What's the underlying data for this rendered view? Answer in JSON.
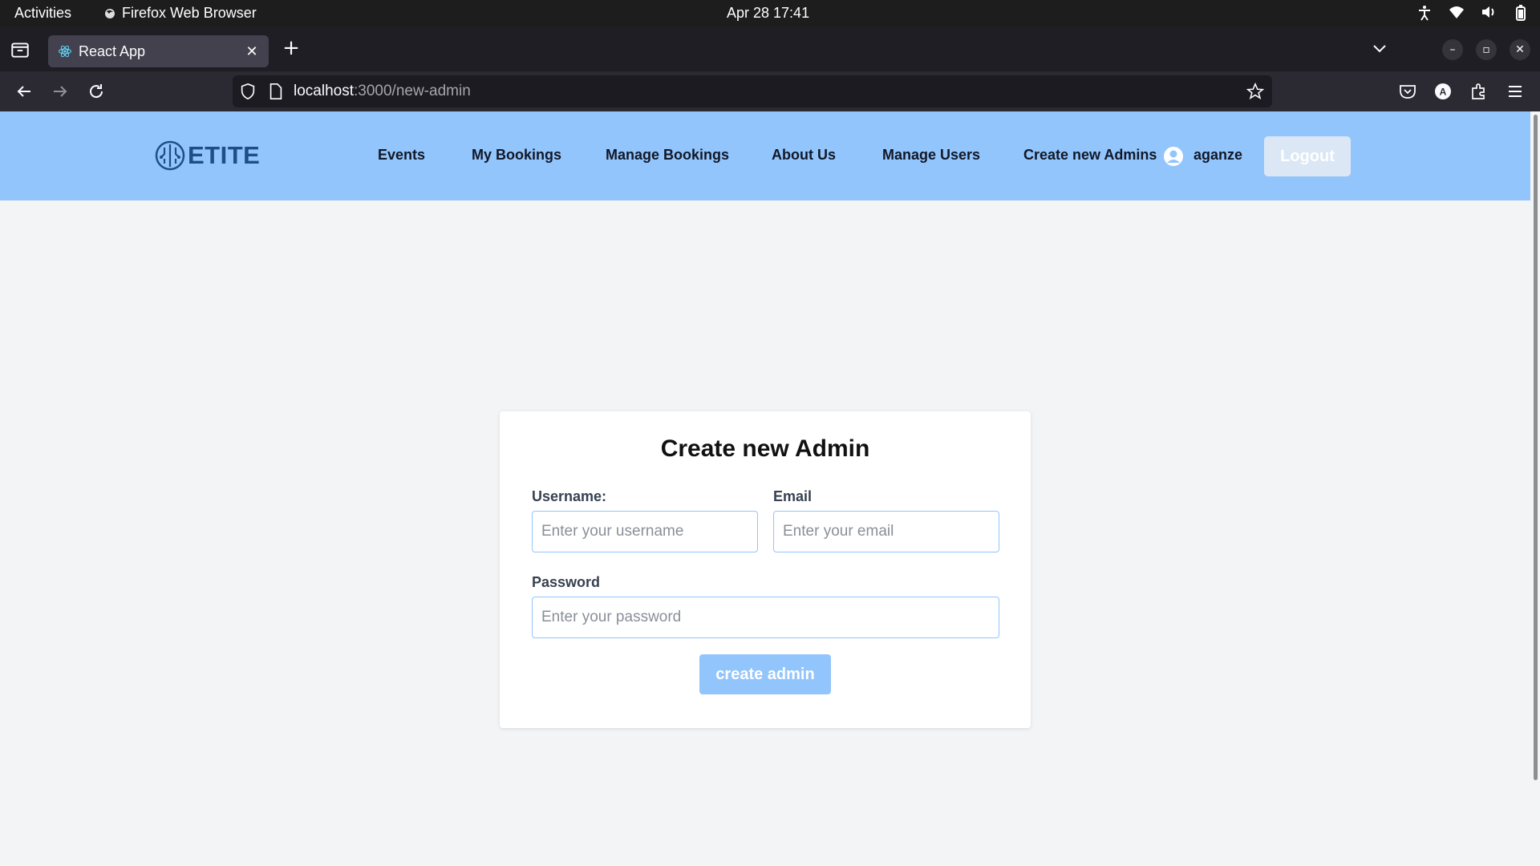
{
  "system_bar": {
    "activities": "Activities",
    "app_name": "Firefox Web Browser",
    "clock": "Apr 28  17:41",
    "tray_icons": [
      "accessibility-icon",
      "wifi-icon",
      "volume-icon",
      "battery-icon"
    ]
  },
  "browser": {
    "tab_title": "React App",
    "url_host": "localhost",
    "url_path": ":3000/new-admin"
  },
  "header": {
    "logo_text": "ETITE",
    "nav": [
      "Events",
      "My Bookings",
      "Manage Bookings",
      "About Us",
      "Manage Users",
      "Create new Admins"
    ],
    "username": "aganze",
    "logout_label": "Logout"
  },
  "form": {
    "title": "Create new Admin",
    "username_label": "Username:",
    "username_placeholder": "Enter your username",
    "email_label": "Email",
    "email_placeholder": "Enter your email",
    "password_label": "Password",
    "password_placeholder": "Enter your password",
    "submit_label": "create admin"
  },
  "colors": {
    "header_bg": "#93c5fd",
    "page_bg": "#f3f4f6",
    "brand": "#1e4f86",
    "button_bg": "#93c5fd"
  }
}
